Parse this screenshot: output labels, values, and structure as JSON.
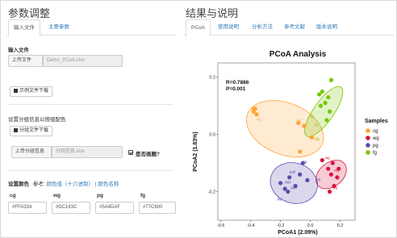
{
  "left_panel": {
    "title": "参数调整",
    "tabs": [
      {
        "label": "输入文件",
        "active": true
      },
      {
        "label": "主要参数",
        "active": false
      }
    ],
    "input_section": {
      "heading": "输入文件",
      "upload_button": "上传文件",
      "file_value": "Demo_PCoA.xlsx",
      "example_download": "示例文件下载"
    },
    "group_section": {
      "heading": "设置分组信息以按组配色",
      "group_download": "分组文件下载",
      "upload_label": "上传分组信息",
      "file_placeholder": "分组信息.xlsx",
      "draw_circle_label": "是否画圈?",
      "draw_circle_checked": true
    },
    "colors_section": {
      "heading": "设置颜色",
      "ref_label": "参考:",
      "ref_link1": "颜色值（十六进制）",
      "ref_sep": "|",
      "ref_link2": "颜色名称",
      "groups": [
        {
          "name": "cg",
          "value": "#FFA334"
        },
        {
          "name": "wg",
          "value": "#DC143C"
        },
        {
          "name": "pg",
          "value": "#5A4DAF"
        },
        {
          "name": "fg",
          "value": "#77C600"
        }
      ]
    }
  },
  "right_panel": {
    "title": "结果与说明",
    "tabs": [
      {
        "label": "PCoA",
        "active": true
      },
      {
        "label": "使用说明",
        "active": false
      },
      {
        "label": "分析方法",
        "active": false
      },
      {
        "label": "参考文献",
        "active": false
      },
      {
        "label": "版本说明",
        "active": false
      }
    ]
  },
  "chart_data": {
    "type": "scatter",
    "title": "PCoA Analysis",
    "xlabel": "PCoA1 (2.09%)",
    "ylabel": "PCoA2 (1.83%)",
    "xlim": [
      -0.62,
      0.3
    ],
    "ylim": [
      -0.3,
      0.25
    ],
    "xticks": [
      "-0.6",
      "-0.4",
      "-0.2",
      "0.0",
      "0.2"
    ],
    "yticks": [
      "-0.2",
      "0.0",
      "0.2"
    ],
    "annotation": [
      "R=0.7886",
      "P=0.001"
    ],
    "legend_title": "Samples",
    "legend_position": "right",
    "ellipses": true,
    "series": [
      {
        "name": "cg",
        "color": "#FFA334",
        "points": [
          [
            -0.38,
            0.08
          ],
          [
            -0.37,
            0.09
          ],
          [
            -0.36,
            0.07
          ],
          [
            -0.38,
            0.09
          ],
          [
            -0.08,
            0.04
          ],
          [
            0.01,
            -0.01
          ],
          [
            -0.07,
            -0.06
          ],
          [
            -0.04,
            0.03
          ]
        ],
        "labels": [
          [
            "cg",
            -0.36,
            0.05
          ],
          [
            "cg",
            -0.09,
            0.045
          ],
          [
            "cg",
            -0.06,
            0.025
          ],
          [
            "cg",
            0.02,
            -0.02
          ]
        ]
      },
      {
        "name": "wg",
        "color": "#DC143C",
        "points": [
          [
            0.08,
            -0.09
          ],
          [
            0.12,
            -0.12
          ],
          [
            0.14,
            -0.14
          ],
          [
            0.15,
            -0.1
          ],
          [
            0.18,
            -0.15
          ],
          [
            0.16,
            -0.18
          ],
          [
            0.13,
            -0.2
          ],
          [
            0.19,
            -0.12
          ]
        ],
        "labels": [
          [
            "wg",
            0.1,
            -0.085
          ],
          [
            "wg",
            0.16,
            -0.13
          ],
          [
            "wg",
            0.15,
            -0.19
          ]
        ]
      },
      {
        "name": "pg",
        "color": "#5A4DAF",
        "points": [
          [
            -0.2,
            -0.17
          ],
          [
            -0.17,
            -0.19
          ],
          [
            -0.14,
            -0.15
          ],
          [
            -0.1,
            -0.18
          ],
          [
            -0.07,
            -0.14
          ],
          [
            -0.05,
            -0.1
          ],
          [
            -0.15,
            -0.2
          ],
          [
            -0.02,
            -0.16
          ]
        ],
        "labels": [
          [
            "pg",
            -0.22,
            -0.23
          ],
          [
            "pg1",
            -0.17,
            -0.17
          ],
          [
            "pg6",
            -0.14,
            -0.135
          ],
          [
            "pg5",
            -0.13,
            -0.19
          ],
          [
            "pg",
            -0.05,
            -0.1
          ],
          [
            "pg",
            0.04,
            -0.16
          ]
        ]
      },
      {
        "name": "fg",
        "color": "#77C600",
        "points": [
          [
            0.06,
            0.14
          ],
          [
            0.08,
            0.15
          ],
          [
            0.1,
            0.11
          ],
          [
            0.12,
            0.13
          ],
          [
            0.07,
            0.1
          ],
          [
            0.13,
            0.08
          ],
          [
            0.14,
            0.19
          ],
          [
            0.11,
            0.05
          ]
        ],
        "labels": [
          [
            "fg",
            0.0,
            0.06
          ],
          [
            "fg",
            0.03,
            0.03
          ],
          [
            "fg",
            0.09,
            0.11
          ],
          [
            "fg",
            0.04,
            -0.02
          ]
        ]
      }
    ]
  }
}
